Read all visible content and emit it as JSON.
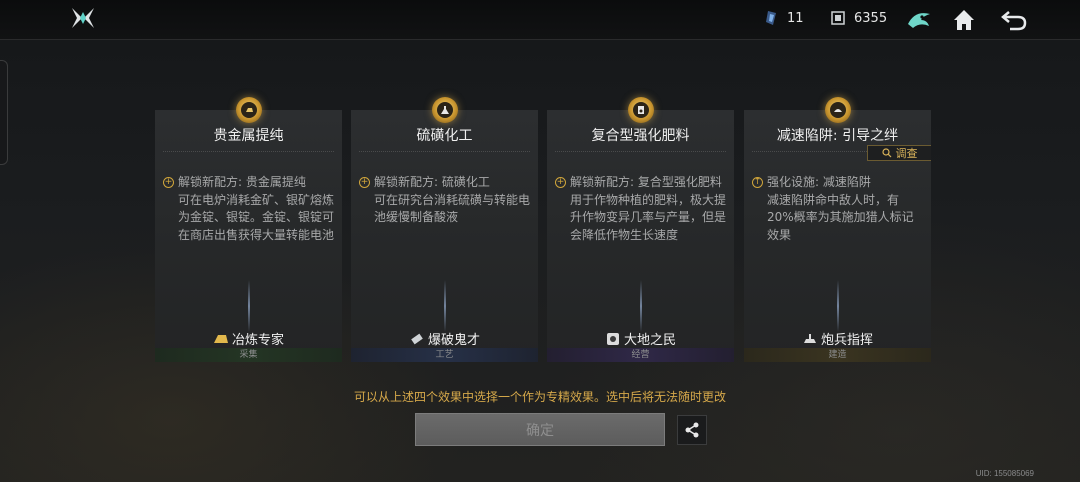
{
  "header": {
    "resources": [
      {
        "icon": "crystal-icon",
        "value": "11"
      },
      {
        "icon": "chip-icon",
        "value": "6355"
      }
    ]
  },
  "cards": [
    {
      "title": "贵金属提纯",
      "effect_line": "解锁新配方: 贵金属提纯",
      "description": "可在电炉消耗金矿、银矿熔炼为金锭、银锭。金锭、银锭可在商店出售获得大量转能电池",
      "skill": "冶炼专家",
      "category": "采集",
      "emblem_icon": "gold-bar-icon"
    },
    {
      "title": "硫磺化工",
      "effect_line": "解锁新配方: 硫磺化工",
      "description": "可在研究台消耗硫磺与转能电池缓慢制备酸液",
      "skill": "爆破鬼才",
      "category": "工艺",
      "emblem_icon": "flask-icon"
    },
    {
      "title": "复合型强化肥料",
      "effect_line": "解锁新配方: 复合型强化肥料",
      "description": "用于作物种植的肥料，极大提升作物变异几率与产量，但是会降低作物生长速度",
      "skill": "大地之民",
      "category": "经营",
      "emblem_icon": "fertilizer-icon"
    },
    {
      "title": "减速陷阱: 引导之绊",
      "effect_line": "强化设施: 减速陷阱",
      "description": "减速陷阱命中敌人时，有20%概率为其施加猎人标记效果",
      "skill": "炮兵指挥",
      "category": "建造",
      "emblem_icon": "trap-icon",
      "survey_label": "调查"
    }
  ],
  "notice": "可以从上述四个效果中选择一个作为专精效果。选中后将无法随时更改",
  "confirm_label": "确定",
  "uid": "UID: 155085069",
  "colors": {
    "gold_accent": "#d5a84a",
    "green_cat": "#243524",
    "blue_cat": "#263047",
    "purple_cat": "#2f2847",
    "gold_cat": "#3a3420"
  }
}
